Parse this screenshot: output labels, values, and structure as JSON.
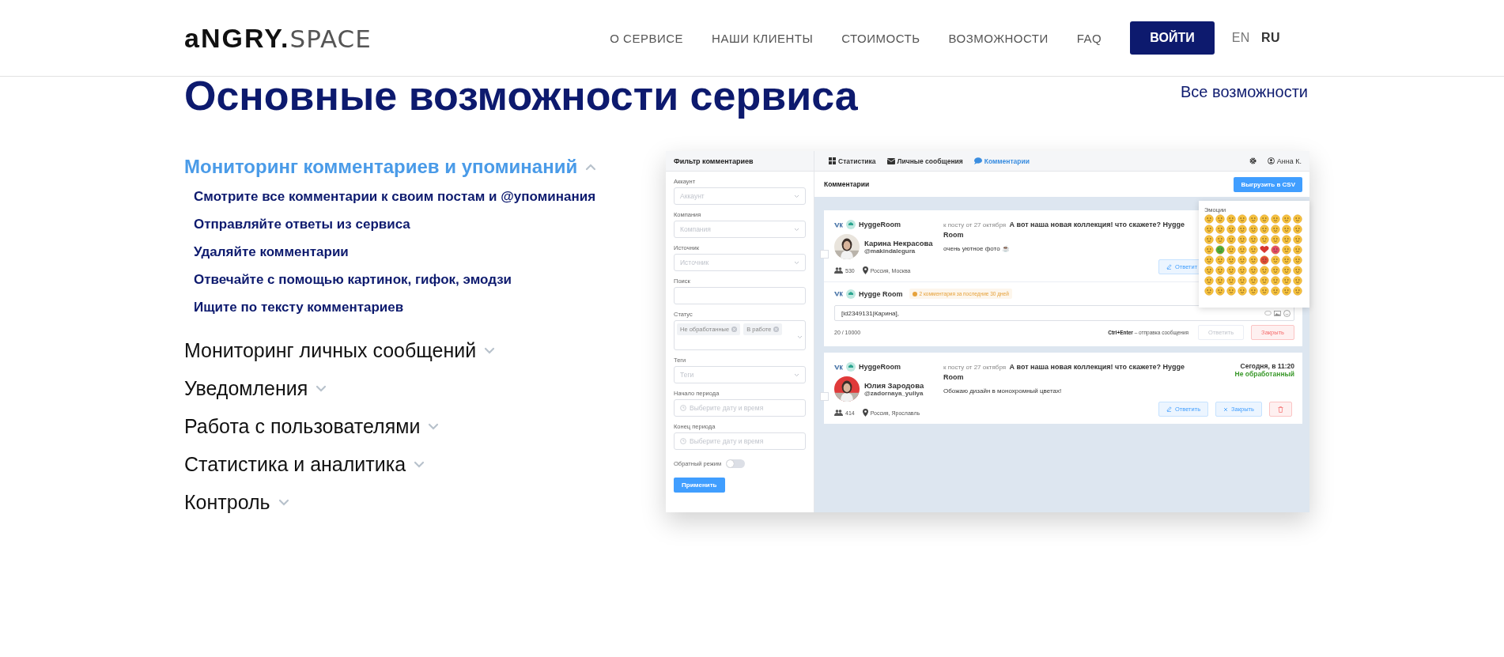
{
  "header": {
    "logo": {
      "bold": "aNGRY.",
      "light": "SPACE"
    },
    "nav": [
      "О СЕРВИСЕ",
      "НАШИ КЛИЕНТЫ",
      "СТОИМОСТЬ",
      "ВОЗМОЖНОСТИ",
      "FAQ"
    ],
    "login_button": "ВОЙТИ",
    "languages": [
      {
        "label": "EN",
        "selected": false
      },
      {
        "label": "RU",
        "selected": true
      }
    ]
  },
  "section": {
    "title": "Основные возможности сервиса",
    "all_link": "Все возможности"
  },
  "features": [
    {
      "title": "Мониторинг комментариев и упоминаний",
      "expanded": true,
      "items": [
        "Смотрите все комментарии к своим постам и @упоминания",
        "Отправляйте ответы из сервиса",
        "Удаляйте комментарии",
        "Отвечайте с помощью картинок, гифок, эмодзи",
        "Ищите по тексту комментариев"
      ]
    },
    {
      "title": "Мониторинг личных сообщений",
      "expanded": false
    },
    {
      "title": "Уведомления",
      "expanded": false
    },
    {
      "title": "Работа с пользователями",
      "expanded": false
    },
    {
      "title": "Статистика и аналитика",
      "expanded": false
    },
    {
      "title": "Контроль",
      "expanded": false
    }
  ],
  "app": {
    "filter": {
      "title": "Фильтр комментариев",
      "fields": [
        {
          "label": "Аккаунт",
          "kind": "select",
          "placeholder": "Аккаунт"
        },
        {
          "label": "Компания",
          "kind": "select",
          "placeholder": "Компания"
        },
        {
          "label": "Источник",
          "kind": "select",
          "placeholder": "Источник"
        },
        {
          "label": "Поиск",
          "kind": "input"
        },
        {
          "label": "Статус",
          "kind": "tags",
          "tags": [
            "Не обработанные",
            "В работе"
          ]
        },
        {
          "label": "Теги",
          "kind": "select",
          "placeholder": "Теги"
        },
        {
          "label": "Начало периода",
          "kind": "date",
          "placeholder": "Выберите дату и время"
        },
        {
          "label": "Конец периода",
          "kind": "date",
          "placeholder": "Выберите дату и время"
        }
      ],
      "toggle": {
        "label": "Обратный режим",
        "on": false
      },
      "apply_button": "Применить"
    },
    "tabs": [
      {
        "label": "Статистика",
        "kind": "stats",
        "selected": false
      },
      {
        "label": "Личные сообщения",
        "kind": "messages",
        "selected": false
      },
      {
        "label": "Комментарии",
        "kind": "comments",
        "selected": true
      }
    ],
    "user": "Анна К.",
    "page_title": "Комментарии",
    "export_button": "Выгрузить в CSV",
    "cards": [
      {
        "account": "HyggeRoom",
        "checked": false,
        "author": "Карина Некрасова",
        "handle": "@makindalegura",
        "post": "к посту от 27 октября  **А вот наша новая коллекция! что скажете? Hygge Room**",
        "text": "очень уютное фото ☕",
        "followers": "530",
        "location": "Россия, Москва",
        "buttons": [
          {
            "label": "Ответит",
            "kind": "reply"
          }
        ],
        "reply": {
          "account": "Hygge Room",
          "notice": "2 комментария за последние 30 дней",
          "value": "[id2349131|Карина],",
          "counter": "20 / 10000",
          "hint_key": "Ctrl+Enter",
          "hint": "– отправка сообщения",
          "buttons": [
            {
              "label": "Ответить",
              "kind": "send",
              "disabled": true
            },
            {
              "label": "Закрыть",
              "kind": "close_red",
              "disabled": false
            }
          ]
        }
      },
      {
        "account": "HyggeRoom",
        "checked": false,
        "author": "Юлия Зародова",
        "handle": "@zadornaya_yuliya",
        "post": "к посту от 27 октября  **А вот наша новая коллекция! что скажете? Hygge Room**",
        "text": "Обожаю дизайн в монохромный цветах!",
        "followers": "414",
        "location": "Россия, Ярославль",
        "time": "Сегодня, в 11:20",
        "status": "Не обработанный",
        "buttons": [
          {
            "label": "Ответить",
            "kind": "reply"
          },
          {
            "label": "Закрыть",
            "kind": "close"
          },
          {
            "kind": "delete"
          }
        ]
      }
    ],
    "emoji_panel": {
      "title": "Эмоции"
    }
  }
}
